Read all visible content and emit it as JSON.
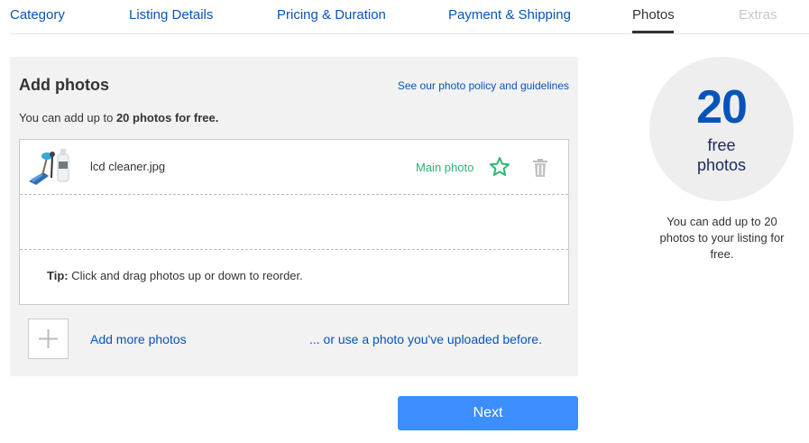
{
  "steps": {
    "category": "Category",
    "listing_details": "Listing Details",
    "pricing_duration": "Pricing & Duration",
    "payment_shipping": "Payment & Shipping",
    "photos": "Photos",
    "extras": "Extras",
    "active": "Photos"
  },
  "photos_panel": {
    "title": "Add photos",
    "policy_link": "See our photo policy and guidelines",
    "free_note_prefix": "You can add up to ",
    "free_note_bold": "20 photos for free.",
    "items": [
      {
        "file_name": "lcd cleaner.jpg",
        "main_label": "Main photo",
        "star_icon": "star-outline-icon",
        "delete_icon": "trash-icon"
      }
    ],
    "tip_label": "Tip:",
    "tip_text": " Click and drag photos up or down to reorder.",
    "add_more": "Add more photos",
    "use_previous": "... or use a photo you've uploaded before."
  },
  "next_button": "Next",
  "free_badge": {
    "number": "20",
    "line1": "free",
    "line2": "photos",
    "note": "You can add up to 20 photos to your listing for free."
  },
  "colors": {
    "link": "#0654ba",
    "main_photo_green": "#2bb673",
    "next_button": "#3c8eff",
    "panel_bg": "#f2f2f2",
    "badge_bg": "#eeeeee"
  }
}
